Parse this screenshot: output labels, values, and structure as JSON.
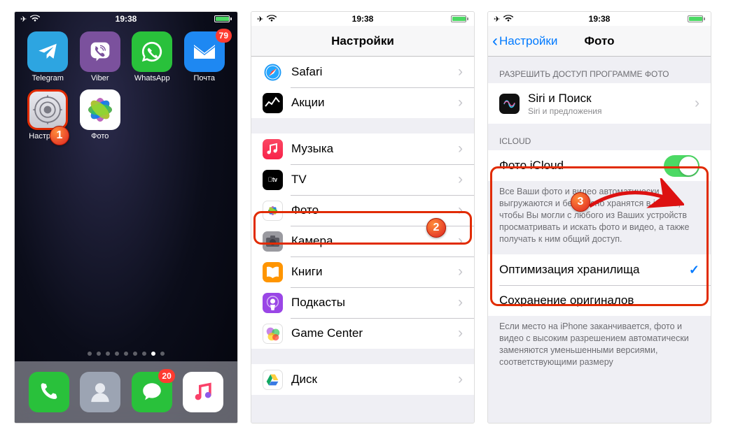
{
  "time": "19:38",
  "battery_pct": 96,
  "home": {
    "apps": [
      {
        "label": "Telegram"
      },
      {
        "label": "Viber"
      },
      {
        "label": "WhatsApp"
      },
      {
        "label": "Почта",
        "badge": "79"
      },
      {
        "label": "Настройки"
      },
      {
        "label": "Фото"
      }
    ],
    "dock_badge_msg": "20"
  },
  "settings": {
    "title": "Настройки",
    "rows": {
      "safari": "Safari",
      "stocks": "Акции",
      "music": "Музыка",
      "tv": "TV",
      "photos": "Фото",
      "camera": "Камера",
      "books": "Книги",
      "podcasts": "Подкасты",
      "gamecenter": "Game Center",
      "drive": "Диск"
    }
  },
  "photos": {
    "back": "Настройки",
    "title": "Фото",
    "allow_header": "РАЗРЕШИТЬ ДОСТУП ПРОГРАММЕ ФОТО",
    "siri_title": "Siri и Поиск",
    "siri_sub": "Siri и предложения",
    "icloud_header": "ICLOUD",
    "icloud_photos": "Фото iCloud",
    "icloud_toggle_on": true,
    "icloud_desc": "Все Ваши фото и видео автоматически выгружаются и безопасно хранятся в iCloud, чтобы Вы могли с любого из Ваших устройств просматривать и искать фото и видео, а также получать к ним общий доступ.",
    "optimize": "Оптимизация хранилища",
    "originals": "Сохранение оригиналов",
    "storage_desc": "Если место на iPhone заканчивается, фото и видео с высоким разрешением автоматически заменяются уменьшенными версиями, соответствующими размеру"
  },
  "steps": {
    "s1": "1",
    "s2": "2",
    "s3": "3"
  }
}
